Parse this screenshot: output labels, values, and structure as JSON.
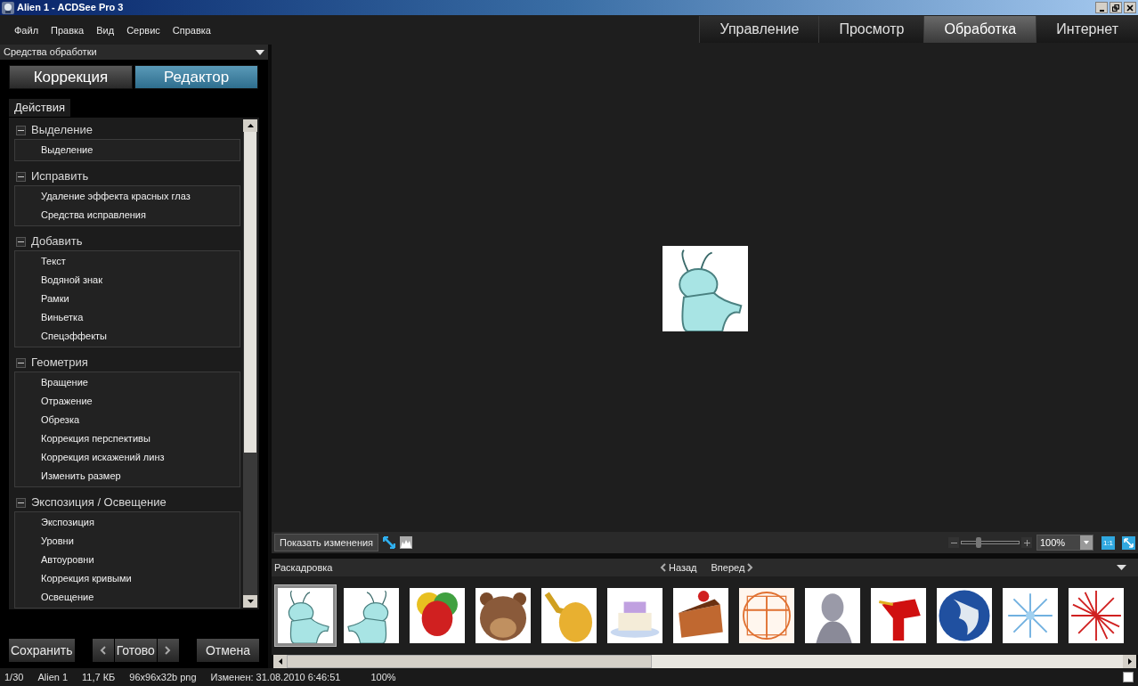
{
  "window": {
    "title": "Alien 1 - ACDSee Pro 3"
  },
  "menu": [
    "Файл",
    "Правка",
    "Вид",
    "Сервис",
    "Справка"
  ],
  "modes": [
    {
      "label": "Управление",
      "selected": false
    },
    {
      "label": "Просмотр",
      "selected": false
    },
    {
      "label": "Обработка",
      "selected": true
    },
    {
      "label": "Интернет",
      "selected": false
    }
  ],
  "panel": {
    "title": "Средства обработки",
    "tabs": [
      {
        "label": "Коррекция",
        "selected": false
      },
      {
        "label": "Редактор",
        "selected": true
      }
    ],
    "subtab": "Действия",
    "groups": [
      {
        "title": "Выделение",
        "expanded": true,
        "items": [
          "Выделение"
        ]
      },
      {
        "title": "Исправить",
        "expanded": true,
        "items": [
          "Удаление эффекта красных глаз",
          "Средства исправления"
        ]
      },
      {
        "title": "Добавить",
        "expanded": true,
        "items": [
          "Текст",
          "Водяной знак",
          "Рамки",
          "Виньетка",
          "Спецэффекты"
        ]
      },
      {
        "title": "Геометрия",
        "expanded": true,
        "items": [
          "Вращение",
          "Отражение",
          "Обрезка",
          "Коррекция перспективы",
          "Коррекция искажений линз",
          "Изменить размер"
        ]
      },
      {
        "title": "Экспозиция / Освещение",
        "expanded": true,
        "items": [
          "Экспозиция",
          "Уровни",
          "Автоуровни",
          "Коррекция кривыми",
          "Освещение"
        ]
      }
    ],
    "save": "Сохранить",
    "done": "Готово",
    "cancel": "Отмена"
  },
  "preview": {
    "show_changes": "Показать изменения",
    "zoom_slider": {
      "level": 0.3
    },
    "zoom_value": "100%",
    "actual_size": "1:1"
  },
  "filmstrip": {
    "title": "Раскадровка",
    "back": "Назад",
    "forward": "Вперед",
    "thumbnails": [
      {
        "selected": true
      },
      {
        "selected": false
      },
      {
        "selected": false
      },
      {
        "selected": false
      },
      {
        "selected": false
      },
      {
        "selected": false
      },
      {
        "selected": false
      },
      {
        "selected": false
      },
      {
        "selected": false
      },
      {
        "selected": false
      },
      {
        "selected": false
      },
      {
        "selected": false
      },
      {
        "selected": false
      }
    ]
  },
  "status_checkbox": {
    "checked": false
  },
  "status_bar": [
    "1/30",
    "Alien 1",
    "11,7 КБ",
    "96x96x32b png",
    "Изменен: 31.08.2010 6:46:51",
    "100%"
  ]
}
